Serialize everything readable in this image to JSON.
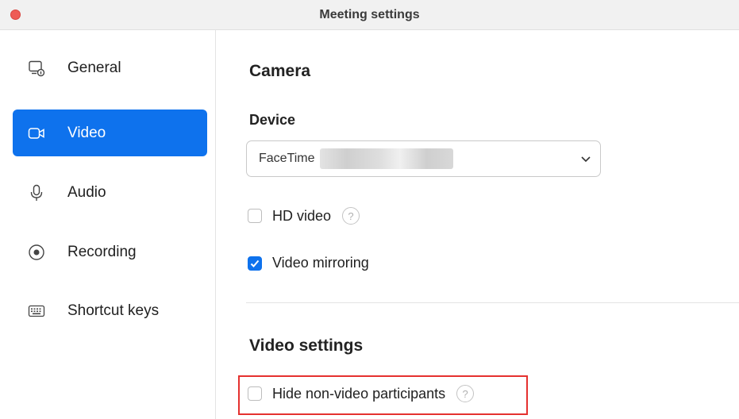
{
  "window": {
    "title": "Meeting settings"
  },
  "sidebar": {
    "items": [
      {
        "label": "General",
        "icon": "general-settings-icon",
        "active": false
      },
      {
        "label": "Video",
        "icon": "video-camera-icon",
        "active": true
      },
      {
        "label": "Audio",
        "icon": "microphone-icon",
        "active": false
      },
      {
        "label": "Recording",
        "icon": "record-icon",
        "active": false
      },
      {
        "label": "Shortcut keys",
        "icon": "keyboard-icon",
        "active": false
      }
    ]
  },
  "main": {
    "camera_heading": "Camera",
    "device_heading": "Device",
    "device_select": {
      "value": "FaceTime"
    },
    "hd_video": {
      "label": "HD video",
      "checked": false
    },
    "video_mirroring": {
      "label": "Video mirroring",
      "checked": true
    },
    "video_settings_heading": "Video settings",
    "hide_non_video": {
      "label": "Hide non-video participants",
      "checked": false
    }
  },
  "colors": {
    "accent": "#0e72ed",
    "highlight_border": "#e5312f",
    "close_button": "#ee5c56"
  }
}
